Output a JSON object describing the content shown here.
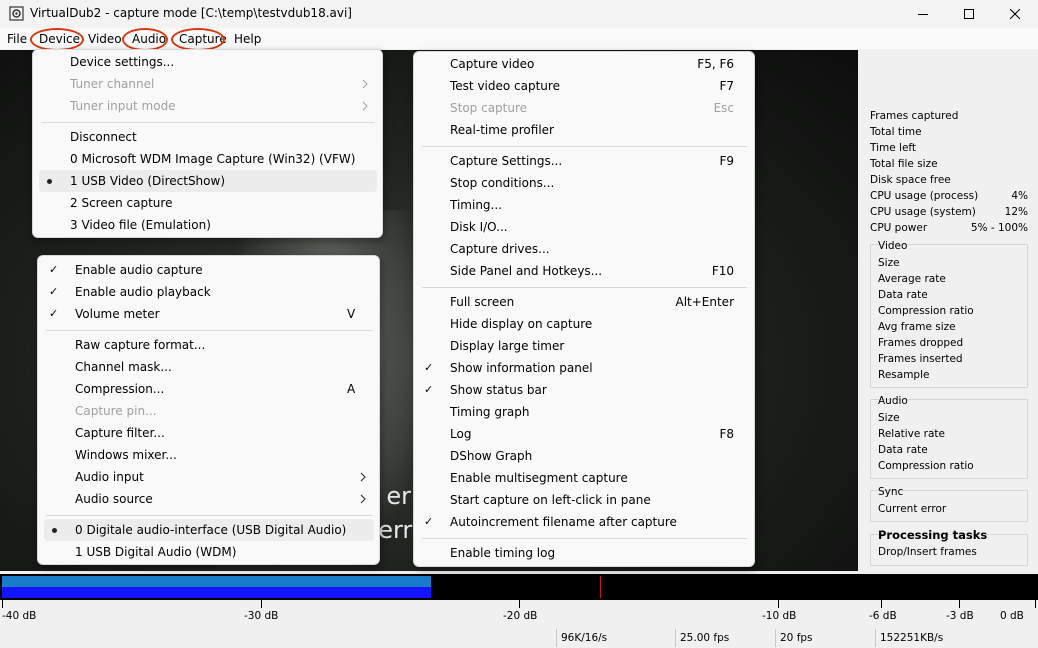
{
  "window": {
    "title": "VirtualDub2  - capture mode [C:\\temp\\testvdub18.avi]",
    "controls": {
      "minimize": "minimize-icon",
      "maximize": "maximize-icon",
      "close": "close-icon"
    }
  },
  "menubar": {
    "items": [
      "File",
      "Device",
      "Video",
      "Audio",
      "Capture",
      "Help"
    ],
    "highlight_color": "#d4390f"
  },
  "video": {
    "subtitle_line1": "e er",
    "subtitle_line2": "verr"
  },
  "device_menu": {
    "items": [
      {
        "label": "Device settings...",
        "disabled": false
      },
      {
        "label": "Tuner channel",
        "disabled": true,
        "submenu": true
      },
      {
        "label": "Tuner input mode",
        "disabled": true,
        "submenu": true
      },
      {
        "label": "Disconnect"
      },
      {
        "label": "0 Microsoft WDM Image Capture (Win32) (VFW)"
      },
      {
        "label": "1 USB Video (DirectShow)",
        "selected": true
      },
      {
        "label": "2 Screen capture"
      },
      {
        "label": "3 Video file (Emulation)"
      }
    ]
  },
  "audio_menu": {
    "items": [
      {
        "label": "Enable audio capture",
        "checked": true
      },
      {
        "label": "Enable audio playback",
        "checked": true
      },
      {
        "label": "Volume meter",
        "checked": true,
        "accel": "V"
      },
      {
        "label": "Raw capture format..."
      },
      {
        "label": "Channel mask..."
      },
      {
        "label": "Compression...",
        "accel": "A"
      },
      {
        "label": "Capture pin...",
        "disabled": true
      },
      {
        "label": "Capture filter..."
      },
      {
        "label": "Windows mixer..."
      },
      {
        "label": "Audio input",
        "submenu": true
      },
      {
        "label": "Audio source",
        "submenu": true
      },
      {
        "label": "0 Digitale audio-interface (USB Digital Audio)",
        "selected": true
      },
      {
        "label": "1 USB Digital Audio (WDM)"
      }
    ]
  },
  "capture_menu": {
    "items": [
      {
        "label": "Capture video",
        "accel": "F5, F6"
      },
      {
        "label": "Test video capture",
        "accel": "F7"
      },
      {
        "label": "Stop capture",
        "accel": "Esc",
        "disabled": true
      },
      {
        "label": "Real-time profiler"
      },
      {
        "label": "Capture Settings...",
        "accel": "F9"
      },
      {
        "label": "Stop conditions..."
      },
      {
        "label": "Timing..."
      },
      {
        "label": "Disk I/O..."
      },
      {
        "label": "Capture drives..."
      },
      {
        "label": "Side Panel and Hotkeys...",
        "accel": "F10"
      },
      {
        "label": "Full screen",
        "accel": "Alt+Enter"
      },
      {
        "label": "Hide display on capture"
      },
      {
        "label": "Display large timer"
      },
      {
        "label": "Show information panel",
        "checked": true
      },
      {
        "label": "Show status bar",
        "checked": true
      },
      {
        "label": "Timing graph"
      },
      {
        "label": "Log",
        "accel": "F8"
      },
      {
        "label": "DShow Graph"
      },
      {
        "label": "Enable multisegment capture"
      },
      {
        "label": "Start capture on left-click in pane"
      },
      {
        "label": "Autoincrement filename after capture",
        "checked": true
      },
      {
        "label": "Enable timing log"
      }
    ]
  },
  "info_panel": {
    "rows": [
      {
        "label": "Frames captured",
        "value": ""
      },
      {
        "label": "Total time",
        "value": ""
      },
      {
        "label": "Time left",
        "value": ""
      },
      {
        "label": "Total file size",
        "value": ""
      },
      {
        "label": "Disk space free",
        "value": ""
      },
      {
        "label": "CPU usage (process)",
        "value": "4%"
      },
      {
        "label": "CPU usage (system)",
        "value": "12%"
      },
      {
        "label": "CPU power",
        "value": "5% - 100%"
      }
    ],
    "video_group": {
      "title": "Video",
      "rows": [
        "Size",
        "Average rate",
        "Data rate",
        "Compression ratio",
        "Avg frame size",
        "Frames dropped",
        "Frames inserted",
        "Resample"
      ]
    },
    "audio_group": {
      "title": "Audio",
      "rows": [
        "Size",
        "Relative rate",
        "Data rate",
        "Compression ratio"
      ]
    },
    "sync_group": {
      "title": "Sync",
      "rows": [
        "Current error"
      ]
    },
    "tasks_group": {
      "title": "Processing tasks",
      "rows": [
        "Drop/Insert frames"
      ]
    }
  },
  "level_meter": {
    "colors": {
      "top": "#1a7bc9",
      "bottom": "#1414ff",
      "peak": "#c01818"
    },
    "scale_labels": [
      "-40 dB",
      "-30 dB",
      "-20 dB",
      "-10 dB",
      "-6 dB",
      "-3 dB",
      "0 dB"
    ]
  },
  "statusbar": {
    "cells": [
      "96K/16/s",
      "25.00 fps",
      "20 fps",
      "152251KB/s"
    ]
  }
}
